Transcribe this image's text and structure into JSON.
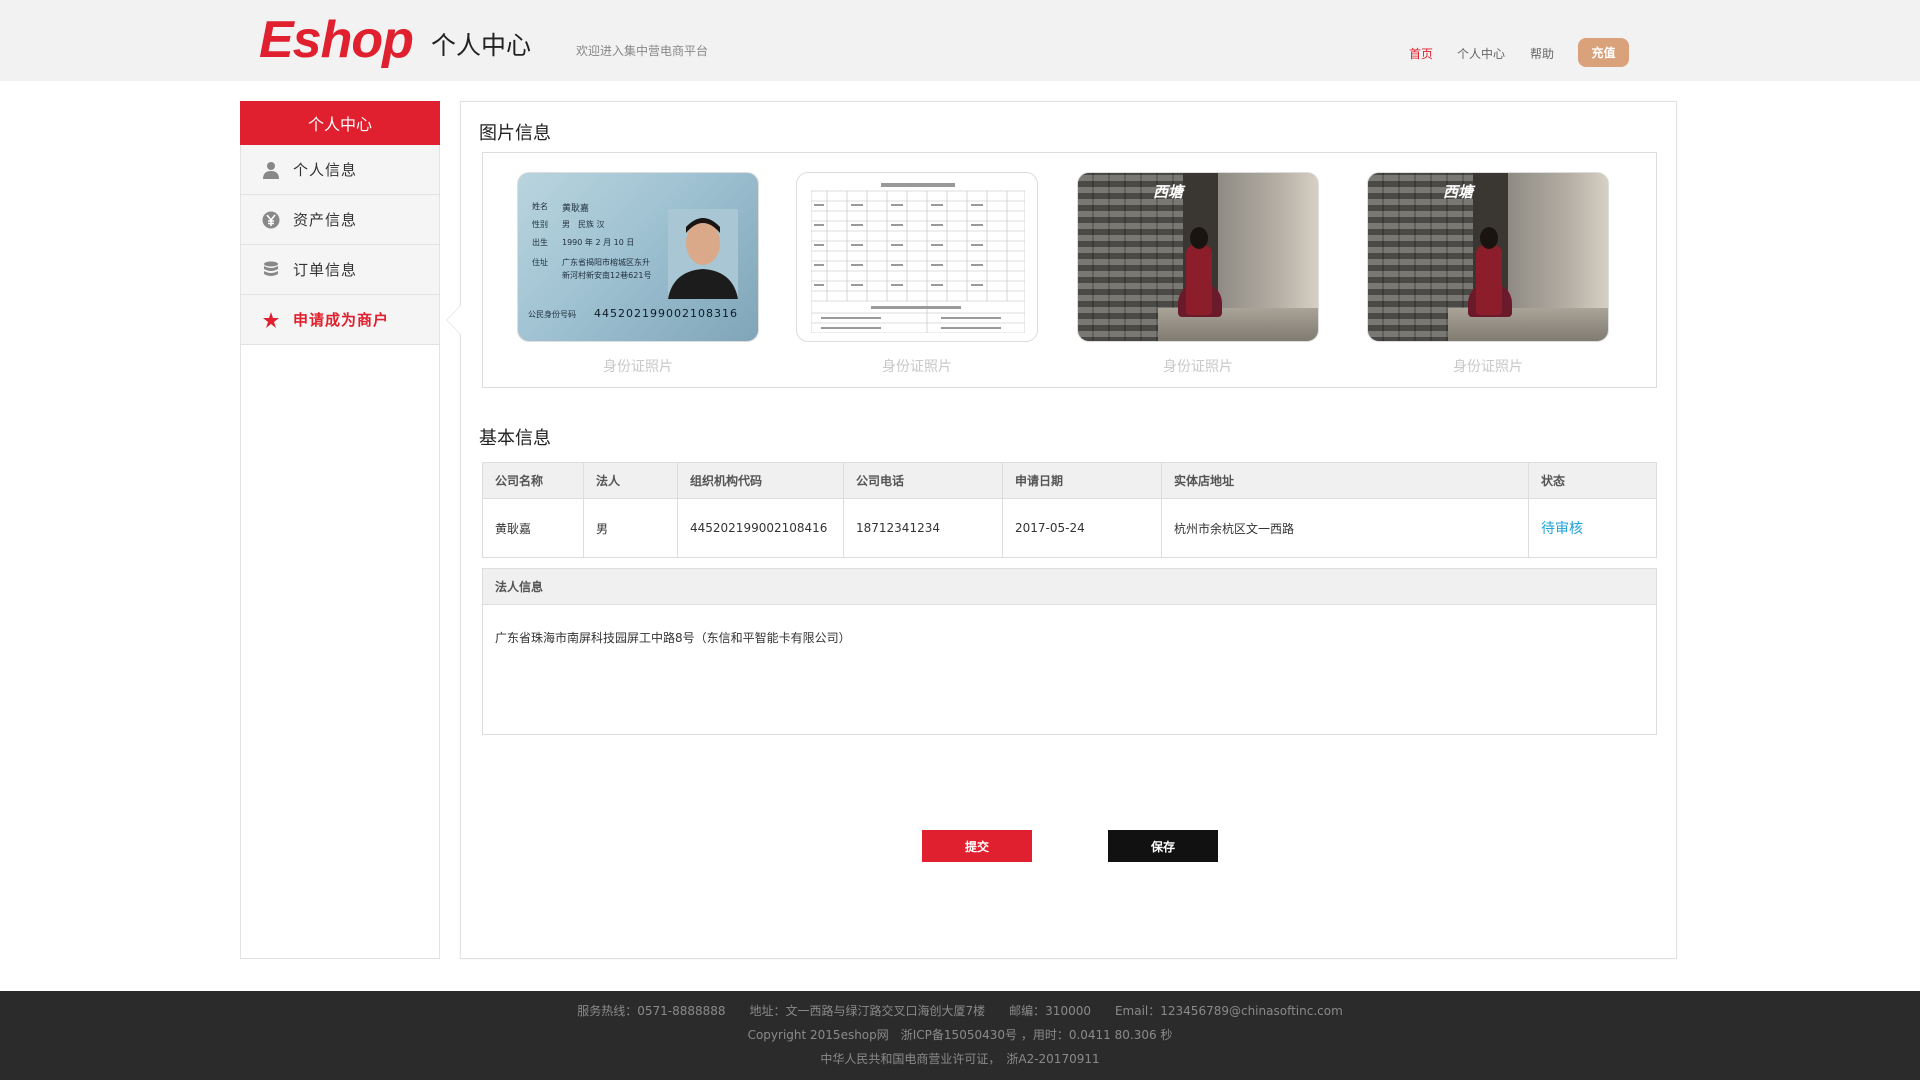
{
  "header": {
    "logo": "Eshop",
    "title": "个人中心",
    "welcome": "欢迎进入集中营电商平台",
    "nav": {
      "home": "首页",
      "center": "个人中心",
      "help": "帮助",
      "recharge": "充值"
    }
  },
  "sidebar": {
    "title": "个人中心",
    "items": [
      {
        "label": "个人信息",
        "icon": "user-icon"
      },
      {
        "label": "资产信息",
        "icon": "yen-icon"
      },
      {
        "label": "订单信息",
        "icon": "coins-icon"
      },
      {
        "label": "申请成为商户",
        "icon": "star-icon",
        "active": true
      }
    ]
  },
  "photos": {
    "section_title": "图片信息",
    "items": [
      {
        "label": "身份证照片"
      },
      {
        "label": "身份证照片"
      },
      {
        "label": "身份证照片"
      },
      {
        "label": "身份证照片"
      }
    ],
    "id_card_number": "445202199002108316"
  },
  "basic": {
    "section_title": "基本信息",
    "headers": [
      "公司名称",
      "法人",
      "组织机构代码",
      "公司电话",
      "申请日期",
      "实体店地址",
      "状态"
    ],
    "row": {
      "company": "黄耿嘉",
      "legal": "男",
      "org_code": "445202199002108416",
      "phone": "18712341234",
      "date": "2017-05-24",
      "address": "杭州市余杭区文一西路",
      "status": "待审核"
    }
  },
  "legal_info": {
    "title": "法人信息",
    "content": "广东省珠海市南屏科技园屏工中路8号（东信和平智能卡有限公司）"
  },
  "buttons": {
    "submit": "提交",
    "save": "保存"
  },
  "footer": {
    "line1": "服务热线：0571-8888888　　地址：文一西路与绿汀路交叉口海创大厦7楼　　邮编：310000　　Email：123456789@chinasoftinc.com",
    "line2": "Copyright 2015eshop网　浙ICP备15050430号 ，用时：0.0411 80.306 秒",
    "line3": "中华人民共和国电商营业许可证，　浙A2-20170911"
  },
  "colors": {
    "accent": "#e0202e",
    "recharge": "#d9a27b",
    "status": "#1fa3d8",
    "footer_bg": "#2b2b2b"
  }
}
